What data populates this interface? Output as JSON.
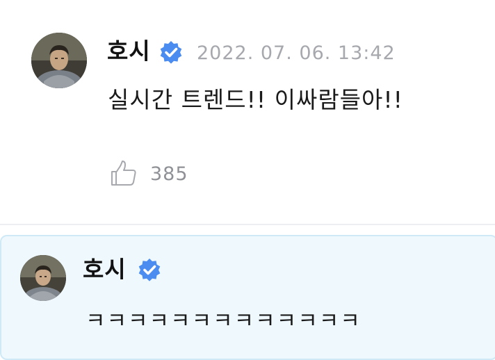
{
  "post": {
    "author": "호시",
    "timestamp": "2022. 07. 06. 13:42",
    "message": "실시간 트렌드!! 이싸람들아!!",
    "like_count": "385",
    "avatar_icon": "profile-photo",
    "verified_icon": "verified-check-badge",
    "like_icon": "thumbs-up-outline"
  },
  "reply": {
    "author": "호시",
    "message": "ㅋㅋㅋㅋㅋㅋㅋㅋㅋㅋㅋㅋㅋ",
    "avatar_icon": "profile-photo",
    "verified_icon": "verified-check-badge"
  },
  "colors": {
    "verified_blue": "#4a8cf0",
    "timestamp_gray": "#a6a8ad",
    "reply_background": "#eef8fd",
    "reply_border": "#cfe9f6"
  }
}
